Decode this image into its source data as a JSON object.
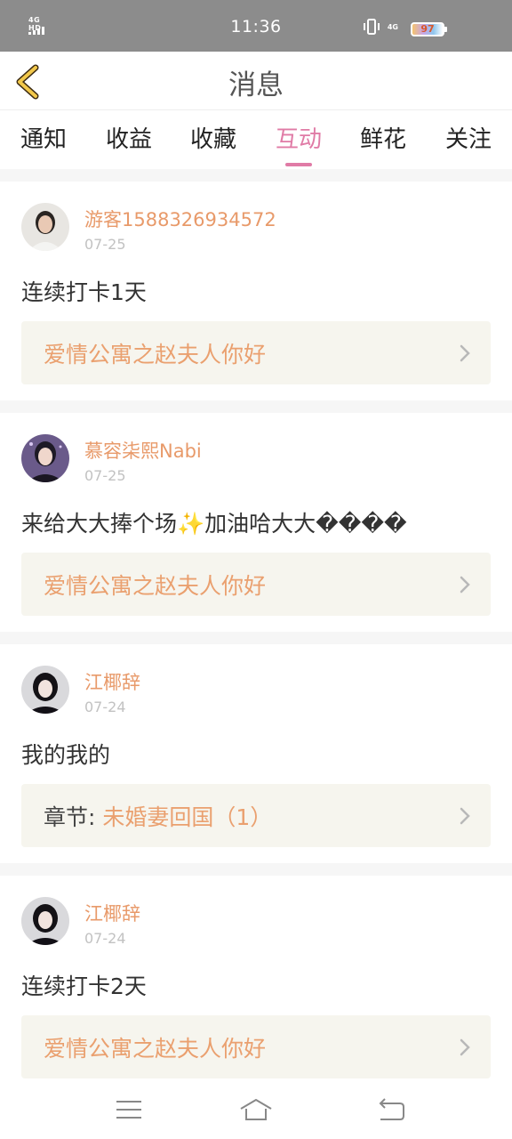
{
  "status_bar": {
    "network_left": "4G HD",
    "time": "11:36",
    "network_right": "4G",
    "battery_level": "97"
  },
  "header": {
    "title": "消息"
  },
  "tabs": [
    {
      "label": "通知",
      "active": false
    },
    {
      "label": "收益",
      "active": false
    },
    {
      "label": "收藏",
      "active": false
    },
    {
      "label": "互动",
      "active": true
    },
    {
      "label": "鲜花",
      "active": false
    },
    {
      "label": "关注",
      "active": false
    }
  ],
  "feed": [
    {
      "username": "游客1588326934572",
      "date": "07-25",
      "content": "连续打卡1天",
      "ref_prefix": "",
      "ref_title": "爱情公寓之赵夫人你好"
    },
    {
      "username": "慕容柒熙Nabi",
      "date": "07-25",
      "content": "来给大大捧个场✨加油哈大大����",
      "ref_prefix": "",
      "ref_title": "爱情公寓之赵夫人你好"
    },
    {
      "username": "江椰辞",
      "date": "07-24",
      "content": "我的我的",
      "ref_prefix": "章节:",
      "ref_title": "未婚妻回国（1）"
    },
    {
      "username": "江椰辞",
      "date": "07-24",
      "content": "连续打卡2天",
      "ref_prefix": "",
      "ref_title": "爱情公寓之赵夫人你好"
    }
  ],
  "colors": {
    "accent": "#e07ba6",
    "username": "#e89a6a",
    "ref_title": "#eaa06f",
    "status_bar_bg": "#8c8c8c",
    "ref_bg": "#f6f5ee",
    "back_arrow": "#f2c84b"
  },
  "icons": {
    "back": "chevron-left-icon",
    "ref_arrow": "chevron-right-icon",
    "nav_menu": "menu-icon",
    "nav_home": "home-icon",
    "nav_back": "back-icon"
  }
}
